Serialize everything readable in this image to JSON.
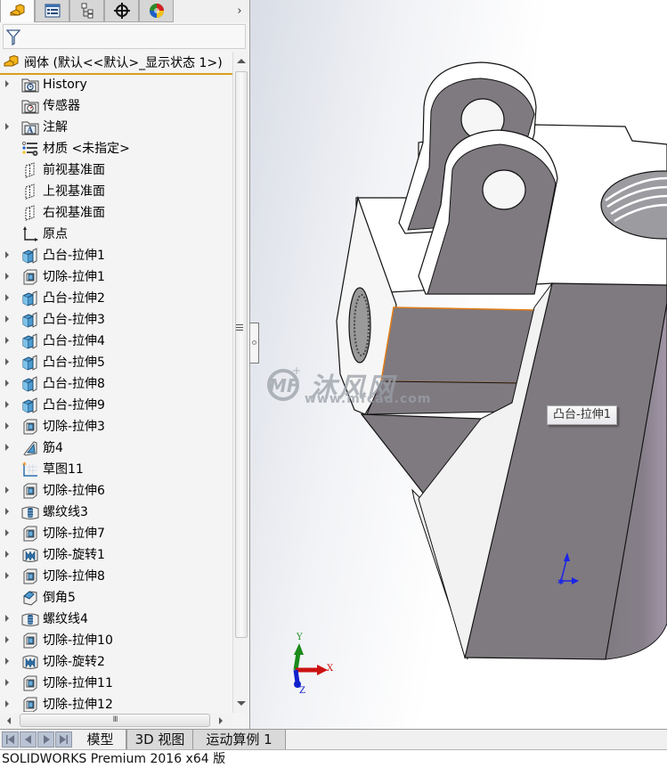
{
  "panel_tabs": [
    {
      "name": "featuremanager",
      "icon": "feature-manager-icon",
      "active": true
    },
    {
      "name": "propertymanager",
      "icon": "property-manager-icon",
      "active": false
    },
    {
      "name": "configurationmanager",
      "icon": "configuration-manager-icon",
      "active": false
    },
    {
      "name": "dimxpertmanager",
      "icon": "dimxpert-crosshair-icon",
      "active": false
    },
    {
      "name": "displaymanager",
      "icon": "display-manager-icon",
      "active": false
    }
  ],
  "panel_tabs_more": "›",
  "filter": {
    "icon": "filter-icon",
    "value": ""
  },
  "root": {
    "label": "阀体  (默认<<默认>_显示状态 1>)",
    "icon": "part-icon"
  },
  "tree": [
    {
      "label": "History",
      "icon": "history-folder-icon",
      "expandable": true
    },
    {
      "label": "传感器",
      "icon": "sensor-folder-icon",
      "expandable": false
    },
    {
      "label": "注解",
      "icon": "annotation-folder-icon",
      "expandable": true
    },
    {
      "label": "材质 <未指定>",
      "icon": "material-icon",
      "expandable": false
    },
    {
      "label": "前视基准面",
      "icon": "plane-icon",
      "expandable": false
    },
    {
      "label": "上视基准面",
      "icon": "plane-icon",
      "expandable": false
    },
    {
      "label": "右视基准面",
      "icon": "plane-icon",
      "expandable": false
    },
    {
      "label": "原点",
      "icon": "origin-icon",
      "expandable": false
    },
    {
      "label": "凸台-拉伸1",
      "icon": "boss-extrude-icon",
      "expandable": true
    },
    {
      "label": "切除-拉伸1",
      "icon": "cut-extrude-icon",
      "expandable": true
    },
    {
      "label": "凸台-拉伸2",
      "icon": "boss-extrude-icon",
      "expandable": true
    },
    {
      "label": "凸台-拉伸3",
      "icon": "boss-extrude-icon",
      "expandable": true
    },
    {
      "label": "凸台-拉伸4",
      "icon": "boss-extrude-icon",
      "expandable": true
    },
    {
      "label": "凸台-拉伸5",
      "icon": "boss-extrude-icon",
      "expandable": true
    },
    {
      "label": "凸台-拉伸8",
      "icon": "boss-extrude-icon",
      "expandable": true
    },
    {
      "label": "凸台-拉伸9",
      "icon": "boss-extrude-icon",
      "expandable": true
    },
    {
      "label": "切除-拉伸3",
      "icon": "cut-extrude-icon",
      "expandable": true
    },
    {
      "label": "筋4",
      "icon": "rib-icon",
      "expandable": true
    },
    {
      "label": "草图11",
      "icon": "sketch-icon",
      "expandable": false
    },
    {
      "label": "切除-拉伸6",
      "icon": "cut-extrude-icon",
      "expandable": true
    },
    {
      "label": "螺纹线3",
      "icon": "thread-icon",
      "expandable": true
    },
    {
      "label": "切除-拉伸7",
      "icon": "cut-extrude-icon",
      "expandable": true
    },
    {
      "label": "切除-旋转1",
      "icon": "cut-revolve-icon",
      "expandable": true
    },
    {
      "label": "切除-拉伸8",
      "icon": "cut-extrude-icon",
      "expandable": true
    },
    {
      "label": "倒角5",
      "icon": "chamfer-icon",
      "expandable": false
    },
    {
      "label": "螺纹线4",
      "icon": "thread-icon",
      "expandable": true
    },
    {
      "label": "切除-拉伸10",
      "icon": "cut-extrude-icon",
      "expandable": true
    },
    {
      "label": "切除-旋转2",
      "icon": "cut-revolve-icon",
      "expandable": true
    },
    {
      "label": "切除-拉伸11",
      "icon": "cut-extrude-icon",
      "expandable": true
    },
    {
      "label": "切除-拉伸12",
      "icon": "cut-extrude-icon",
      "expandable": true
    }
  ],
  "viewport": {
    "tooltip": "凸台-拉伸1",
    "watermark": {
      "brand": "沐风网",
      "url": "www.mfcad.com",
      "logo": "MF"
    },
    "triad": {
      "x": "X",
      "y": "Y",
      "z": "Z"
    },
    "colors": {
      "face_dark": "#7f7a80",
      "face_light": "#f2f2f2",
      "selection_edge": "#e07b16",
      "triad_x": "#cc1111",
      "triad_y": "#1b8a1b",
      "triad_z": "#1020cc",
      "sketch_origin": "#1a24e8"
    }
  },
  "bottom_tabs": [
    {
      "label": "模型",
      "active": true
    },
    {
      "label": "3D 视图",
      "active": false
    },
    {
      "label": "运动算例 1",
      "active": false
    }
  ],
  "nav_buttons": [
    "first",
    "previous",
    "next",
    "last"
  ],
  "status": "SOLIDWORKS Premium 2016 x64 版",
  "scrollbar_grip": "III"
}
